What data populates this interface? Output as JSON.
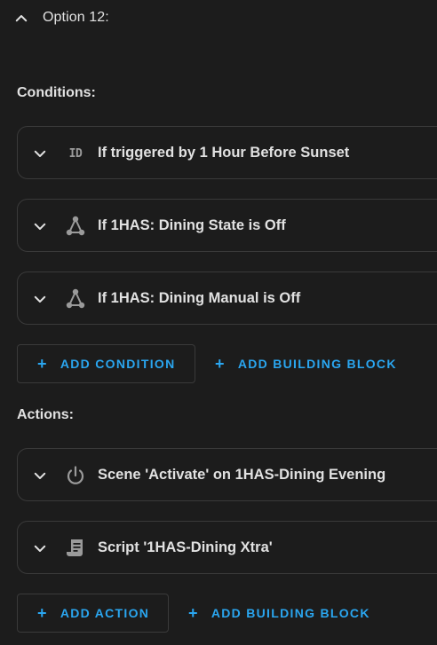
{
  "option": {
    "title": "Option 12:"
  },
  "conditions": {
    "title": "Conditions:",
    "items": [
      {
        "icon": "id-icon",
        "badge": "ID",
        "label": "If triggered by 1 Hour Before Sunset"
      },
      {
        "icon": "graph-icon",
        "label": "If 1HAS: Dining State is Off"
      },
      {
        "icon": "graph-icon",
        "label": "If 1HAS: Dining Manual is Off"
      }
    ],
    "add_condition": "ADD CONDITION",
    "add_building_block": "ADD BUILDING BLOCK"
  },
  "actions": {
    "title": "Actions:",
    "items": [
      {
        "icon": "power-icon",
        "label": "Scene 'Activate' on 1HAS-Dining Evening"
      },
      {
        "icon": "script-icon",
        "label": "Script '1HAS-Dining Xtra'"
      }
    ],
    "add_action": "ADD ACTION",
    "add_building_block": "ADD BUILDING BLOCK"
  },
  "colors": {
    "background": "#1c1c1c",
    "accent": "#2aa6f0",
    "text": "#e1e1e1",
    "border": "#3a3a3a",
    "icon": "#9a9a9a"
  }
}
